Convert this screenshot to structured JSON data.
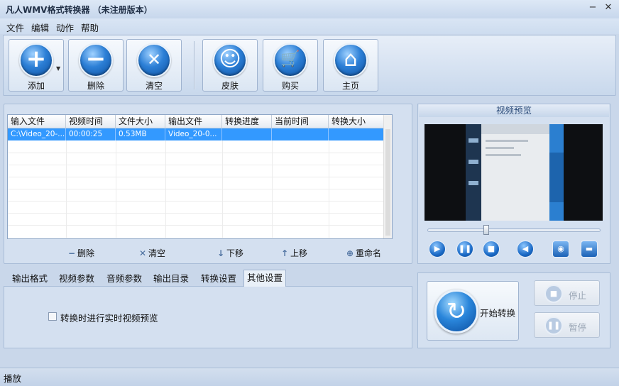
{
  "window": {
    "title": "凡人WMV格式转换器 （未注册版本）",
    "minimize_glyph": "−",
    "close_glyph": "✕"
  },
  "menu": [
    "文件",
    "编辑",
    "动作",
    "帮助"
  ],
  "toolbar": {
    "add": {
      "label": "添加",
      "icon": "plus-icon",
      "glyph": "+"
    },
    "delete": {
      "label": "删除",
      "icon": "minus-icon",
      "glyph": "−"
    },
    "clear": {
      "label": "清空",
      "icon": "x-icon",
      "glyph": "✕"
    },
    "skin": {
      "label": "皮肤",
      "icon": "smiley-icon",
      "glyph": "☺"
    },
    "buy": {
      "label": "购买",
      "icon": "cart-icon",
      "glyph": "🛒"
    },
    "home": {
      "label": "主页",
      "icon": "home-icon",
      "glyph": "⌂"
    }
  },
  "file_table": {
    "columns": [
      "输入文件",
      "视频时间",
      "文件大小",
      "输出文件",
      "转换进度",
      "当前时间",
      "转换大小"
    ],
    "rows": [
      [
        "C:\\Video_20-...",
        "00:00:25",
        "0.53MB",
        "Video_20-0...",
        "",
        "",
        ""
      ]
    ]
  },
  "list_actions": {
    "delete": "删除",
    "clear": "清空",
    "move_down": "下移",
    "move_up": "上移",
    "rename": "重命名"
  },
  "tabs": [
    "输出格式",
    "视频参数",
    "音频参数",
    "输出目录",
    "转换设置",
    "其他设置"
  ],
  "active_tab": "其他设置",
  "other_settings": {
    "realtime_preview_label": "转换时进行实时视频预览",
    "realtime_preview_checked": false
  },
  "preview": {
    "title": "视频预览",
    "seek_position": 0.34
  },
  "player_controls": [
    "play-icon",
    "pause-icon",
    "stop-icon",
    "volume-icon",
    "snapshot-icon",
    "folder-icon"
  ],
  "convert": {
    "start_label": "开始转换",
    "stop_label": "停止",
    "pause_label": "暂停"
  },
  "status": {
    "text": "播放"
  },
  "colors": {
    "accent": "#3399ff",
    "window_bg": "#c9d7ea"
  }
}
